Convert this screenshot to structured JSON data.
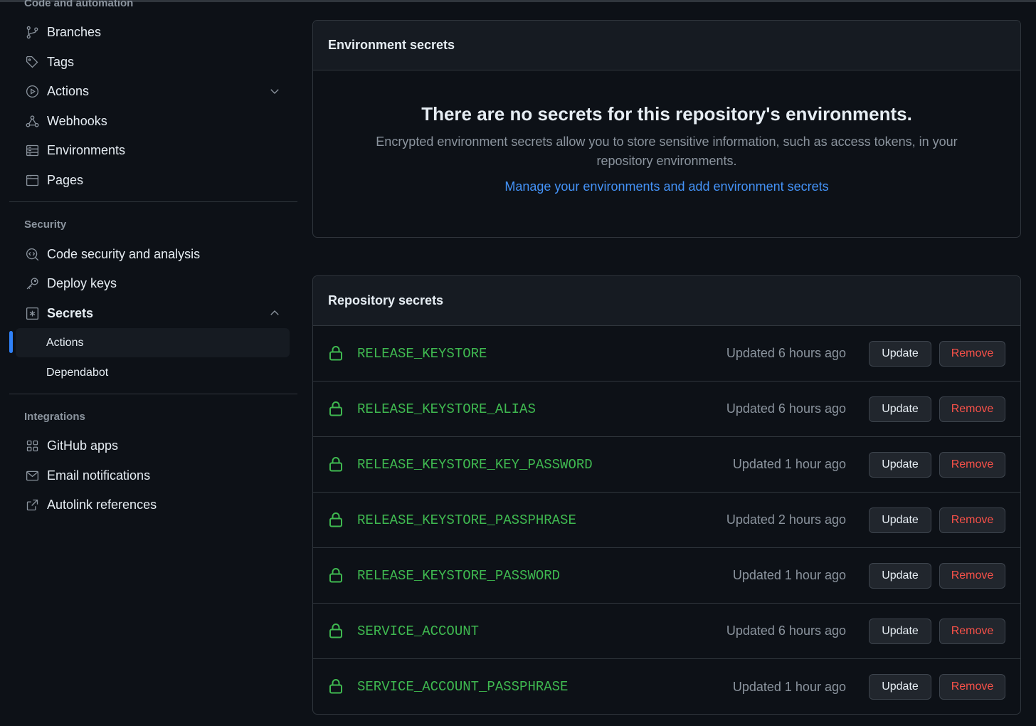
{
  "sidebar": {
    "code_heading": "Code and automation",
    "code_items": [
      {
        "label": "Branches",
        "icon": "branch-icon"
      },
      {
        "label": "Tags",
        "icon": "tag-icon"
      },
      {
        "label": "Actions",
        "icon": "play-icon"
      },
      {
        "label": "Webhooks",
        "icon": "webhook-icon"
      },
      {
        "label": "Environments",
        "icon": "server-icon"
      },
      {
        "label": "Pages",
        "icon": "browser-icon"
      }
    ],
    "security_heading": "Security",
    "security_items": [
      {
        "label": "Code security and analysis",
        "icon": "codescan-icon"
      },
      {
        "label": "Deploy keys",
        "icon": "key-icon"
      },
      {
        "label": "Secrets",
        "icon": "asterisk-icon"
      }
    ],
    "secrets_sub": [
      {
        "label": "Actions",
        "active": true
      },
      {
        "label": "Dependabot",
        "active": false
      }
    ],
    "integrations_heading": "Integrations",
    "integration_items": [
      {
        "label": "GitHub apps",
        "icon": "apps-icon"
      },
      {
        "label": "Email notifications",
        "icon": "mail-icon"
      },
      {
        "label": "Autolink references",
        "icon": "link-external-icon"
      }
    ]
  },
  "env_secrets": {
    "title": "Environment secrets",
    "empty_title": "There are no secrets for this repository's environments.",
    "empty_text": "Encrypted environment secrets allow you to store sensitive information, such as access tokens, in your repository environments.",
    "link": "Manage your environments and add environment secrets"
  },
  "repo_secrets": {
    "title": "Repository secrets",
    "update_label": "Update",
    "remove_label": "Remove",
    "rows": [
      {
        "name": "RELEASE_KEYSTORE",
        "updated": "Updated 6 hours ago"
      },
      {
        "name": "RELEASE_KEYSTORE_ALIAS",
        "updated": "Updated 6 hours ago"
      },
      {
        "name": "RELEASE_KEYSTORE_KEY_PASSWORD",
        "updated": "Updated 1 hour ago"
      },
      {
        "name": "RELEASE_KEYSTORE_PASSPHRASE",
        "updated": "Updated 2 hours ago"
      },
      {
        "name": "RELEASE_KEYSTORE_PASSWORD",
        "updated": "Updated 1 hour ago"
      },
      {
        "name": "SERVICE_ACCOUNT",
        "updated": "Updated 6 hours ago"
      },
      {
        "name": "SERVICE_ACCOUNT_PASSPHRASE",
        "updated": "Updated 1 hour ago"
      }
    ]
  },
  "colors": {
    "accent": "#2f81f7",
    "secret_name": "#3fb950",
    "danger": "#f85149"
  }
}
